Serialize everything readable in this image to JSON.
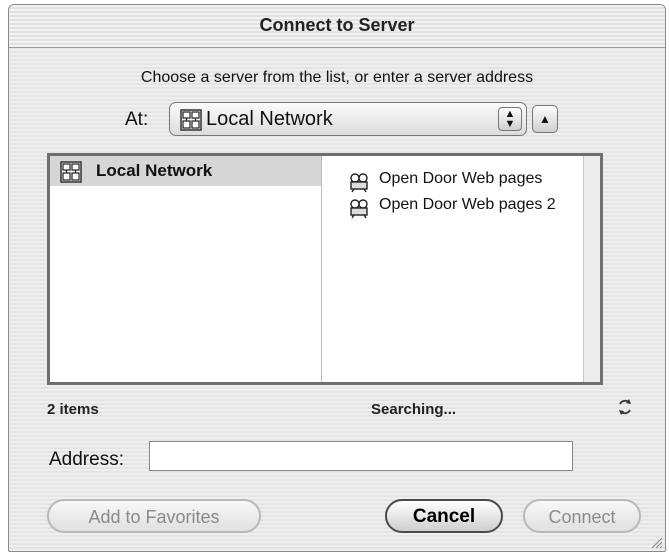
{
  "window": {
    "title": "Connect to Server"
  },
  "prompt": "Choose a server from the list, or enter a server address",
  "location": {
    "label": "At:",
    "selected": "Local Network"
  },
  "browser": {
    "left_column": {
      "selected_item": "Local Network"
    },
    "servers": [
      {
        "name": "Open Door Web pages"
      },
      {
        "name": "Open Door Web pages 2"
      }
    ]
  },
  "status_bar": {
    "item_count": "2 items",
    "status": "Searching..."
  },
  "address": {
    "label": "Address:",
    "value": "",
    "placeholder": ""
  },
  "buttons": {
    "add_to_favorites": "Add to Favorites",
    "cancel": "Cancel",
    "connect": "Connect"
  },
  "icons": {
    "network": "network-icon",
    "server": "server-icon",
    "refresh": "refresh-icon",
    "up": "up-arrow-icon"
  }
}
